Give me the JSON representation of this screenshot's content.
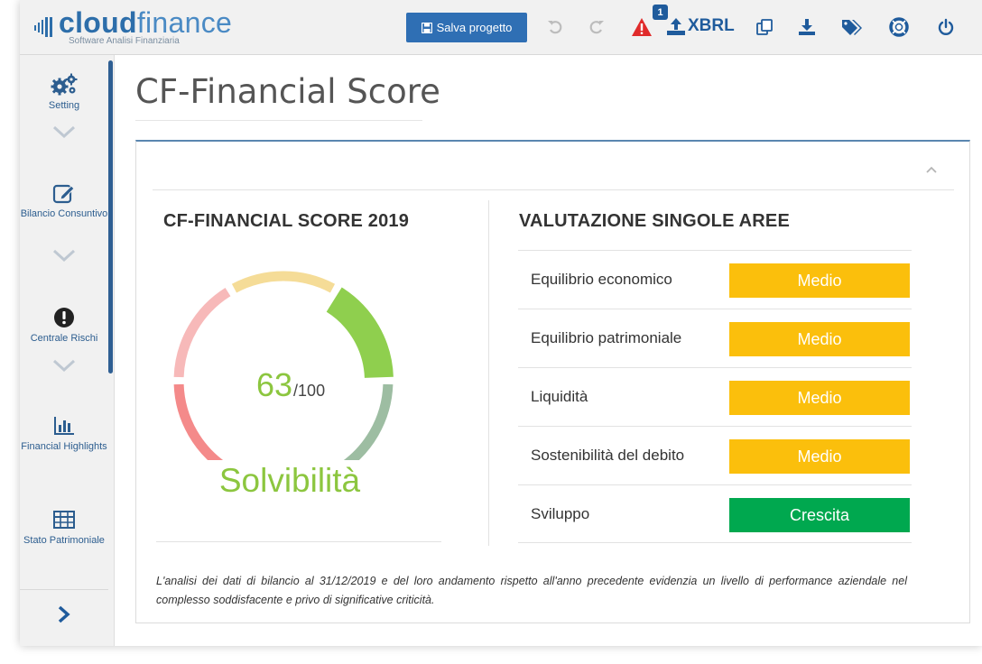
{
  "app": {
    "logo_bold": "cloud",
    "logo_light": "finance",
    "logo_sub": "Software Analisi Finanziaria",
    "save_label": "Salva progetto",
    "warning_count": "1",
    "xbrl_label": "XBRL"
  },
  "toolbar": {
    "icons": [
      "undo-icon",
      "redo-icon",
      "warning-icon",
      "upload-xbrl-icon",
      "copy-icon",
      "download-icon",
      "tags-icon",
      "help-lifebuoy-icon",
      "power-icon"
    ]
  },
  "sidebar": {
    "items": [
      {
        "label": "Setting",
        "icon": "gears-icon"
      },
      {
        "label": "Bilancio Consuntivo",
        "icon": "edit-icon"
      },
      {
        "label": "Centrale Rischi",
        "icon": "exclamation-circle-icon"
      },
      {
        "label": "Financial Highlights",
        "icon": "bar-chart-icon"
      },
      {
        "label": "Stato Patrimoniale",
        "icon": "table-icon"
      }
    ]
  },
  "page": {
    "title": "CF-Financial Score"
  },
  "score": {
    "title": "CF-FINANCIAL SCORE 2019",
    "value": "63",
    "max": "/100",
    "value_fraction": 0.63,
    "label": "Solvibilità",
    "colors": [
      "#f48a8a",
      "#f7b9b9",
      "#f5dc97",
      "#8fcf4e",
      "#9dbda2"
    ],
    "active_color": "#8cc63f"
  },
  "areas": {
    "title": "VALUTAZIONE SINGOLE AREE",
    "rows": [
      {
        "label": "Equilibrio economico",
        "value": "Medio",
        "color": "#fbbf0c"
      },
      {
        "label": "Equilibrio patrimoniale",
        "value": "Medio",
        "color": "#fbbf0c"
      },
      {
        "label": "Liquidità",
        "value": "Medio",
        "color": "#fbbf0c"
      },
      {
        "label": "Sostenibilità del debito",
        "value": "Medio",
        "color": "#fbbf0c"
      },
      {
        "label": "Sviluppo",
        "value": "Crescita",
        "color": "#00a84f"
      }
    ]
  },
  "note": "L'analisi dei dati di bilancio al 31/12/2019 e del loro andamento rispetto all'anno precedente evidenzia un livello di performance aziendale nel complesso soddisfacente e privo di significative criticità."
}
